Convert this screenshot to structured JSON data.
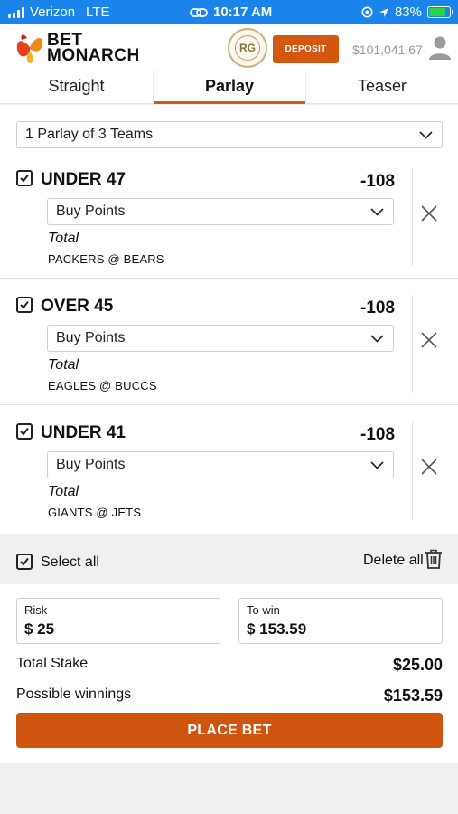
{
  "status_bar": {
    "carrier": "Verizon",
    "network": "LTE",
    "time": "10:17 AM",
    "battery_text": "83%",
    "battery_level": 0.83
  },
  "header": {
    "brand_line1": "BET",
    "brand_line2": "MONARCH",
    "rg_badge": "RG",
    "deposit_label": "DEPOSIT",
    "balance": "$101,041.67"
  },
  "tabs": [
    {
      "label": "Straight",
      "active": false
    },
    {
      "label": "Parlay",
      "active": true
    },
    {
      "label": "Teaser",
      "active": false
    }
  ],
  "parlay_select": {
    "value": "1 Parlay of 3 Teams"
  },
  "legs": [
    {
      "selection": "UNDER 47",
      "odds": "-108",
      "option": "Buy Points",
      "market": "Total",
      "matchup": "PACKERS @ BEARS",
      "checked": true
    },
    {
      "selection": "OVER 45",
      "odds": "-108",
      "option": "Buy Points",
      "market": "Total",
      "matchup": "EAGLES @ BUCCS",
      "checked": true
    },
    {
      "selection": "UNDER 41",
      "odds": "-108",
      "option": "Buy Points",
      "market": "Total",
      "matchup": "GIANTS @ JETS",
      "checked": true
    }
  ],
  "controls": {
    "select_all_label": "Select all",
    "delete_all_label": "Delete all"
  },
  "stake": {
    "risk_label": "Risk",
    "risk_value": "$ 25",
    "win_label": "To win",
    "win_value": "$ 153.59",
    "total_stake_label": "Total Stake",
    "total_stake_value": "$25.00",
    "possible_label": "Possible winnings",
    "possible_value": "$153.59",
    "place_bet_label": "PLACE BET"
  },
  "colors": {
    "status_bar": "#1a84ea",
    "accent": "#d4570f",
    "background": "#f0f0f0"
  },
  "icons": [
    "signal-icon",
    "sync-icon",
    "location-icon",
    "battery-icon",
    "user-icon",
    "chevron-down-icon",
    "checkbox-icon",
    "close-icon",
    "trash-icon"
  ]
}
